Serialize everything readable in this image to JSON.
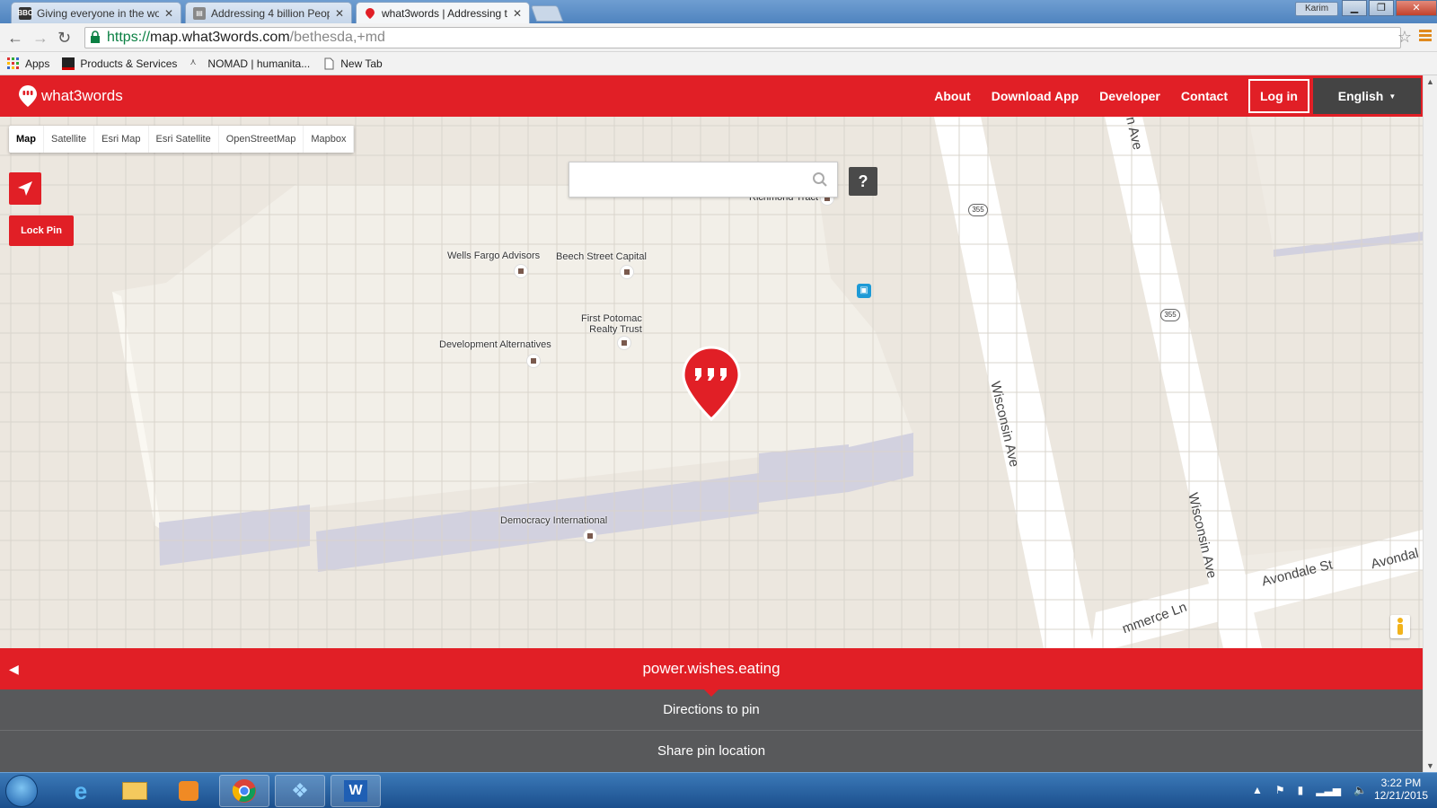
{
  "browser": {
    "tabs": [
      {
        "label": "Giving everyone in the wo",
        "favicon": "bbc-icon"
      },
      {
        "label": "Addressing 4 billion Peopl",
        "favicon": "page-icon"
      },
      {
        "label": "what3words | Addressing t",
        "favicon": "w3w-icon"
      }
    ],
    "user": "Karim",
    "url": {
      "scheme": "https://",
      "host": "map.what3words.com",
      "path": "/bethesda,+md"
    },
    "bookmarks": [
      {
        "label": "Apps"
      },
      {
        "label": "Products & Services"
      },
      {
        "label": "NOMAD | humanita..."
      },
      {
        "label": "New Tab"
      }
    ]
  },
  "header": {
    "logo_text": "what3words",
    "nav": [
      "About",
      "Download App",
      "Developer",
      "Contact"
    ],
    "login": "Log in",
    "language": "English"
  },
  "map": {
    "layers": [
      "Map",
      "Satellite",
      "Esri Map",
      "Esri Satellite",
      "OpenStreetMap",
      "Mapbox"
    ],
    "active_layer": "Map",
    "lock_pin": "Lock Pin",
    "search_placeholder": "",
    "help": "?",
    "places": [
      "Richmond Tract",
      "Wells Fargo Advisors",
      "Beech Street Capital",
      "First Potomac Realty Trust",
      "Development Alternatives",
      "Democracy International"
    ],
    "first_potomac_line1": "First Potomac",
    "first_potomac_line2": "Realty Trust",
    "roads": [
      "Wisconsin Ave",
      "Wisconsin Ave",
      "Avondale St",
      "Avondal",
      "mmerce Ln",
      "n Ave"
    ],
    "route_shield": "355"
  },
  "bottom": {
    "address": "power.wishes.eating",
    "directions": "Directions to pin",
    "share": "Share pin location"
  },
  "taskbar": {
    "time": "3:22 PM",
    "date": "12/21/2015"
  },
  "colors": {
    "brand": "#e11f26",
    "panel": "#58595b",
    "lang": "#444444"
  }
}
